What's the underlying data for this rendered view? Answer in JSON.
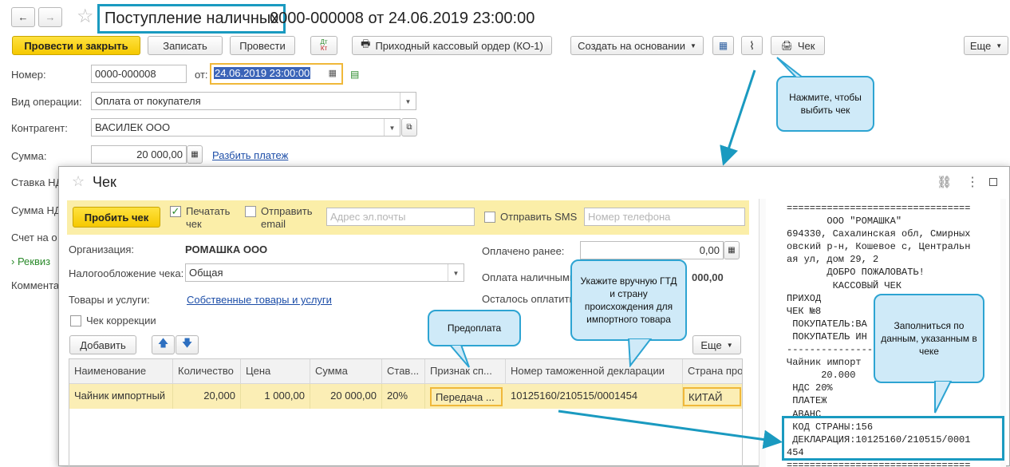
{
  "window": {
    "title_part1": "Поступление наличных",
    "title_part2": "0000-000008 от 24.06.2019 23:00:00",
    "nav_back": "←",
    "nav_forward": "→",
    "star": "☆"
  },
  "toolbar": {
    "post_close": "Провести и закрыть",
    "save": "Записать",
    "post": "Провести",
    "dt_kt_top": "Дт",
    "dt_kt_bottom": "Кт",
    "cash_order": "Приходный кассовый ордер (КО-1)",
    "create_basis": "Создать на основании",
    "receipt": "Чек",
    "more": "Еще"
  },
  "form": {
    "number_label": "Номер:",
    "number_value": "0000-000008",
    "from_label": "от:",
    "date_value": "24.06.2019 23:00:00",
    "operation_label": "Вид операции:",
    "operation_value": "Оплата от покупателя",
    "counterparty_label": "Контрагент:",
    "counterparty_value": "ВАСИЛЕК ООО",
    "sum_label": "Сумма:",
    "sum_value": "20 000,00",
    "split_link": "Разбить платеж",
    "vat_rate_label": "Ставка НД",
    "vat_sum_label": "Сумма НД",
    "account_label": "Счет на о",
    "requisites_label": "Реквиз",
    "comment_label": "Коммента"
  },
  "dialog": {
    "title": "Чек",
    "punch_button": "Пробить чек",
    "print_label_1": "Печатать",
    "print_label_2": "чек",
    "send_email_1": "Отправить",
    "send_email_2": "email",
    "email_placeholder": "Адрес эл.почты",
    "send_sms": "Отправить SMS",
    "phone_placeholder": "Номер телефона",
    "org_label": "Организация:",
    "org_value": "РОМАШКА ООО",
    "tax_label": "Налогообложение чека:",
    "tax_value": "Общая",
    "goods_label": "Товары и услуги:",
    "goods_link": "Собственные товары и услуги",
    "correction_label": "Чек коррекции",
    "paid_before_label": "Оплачено ранее:",
    "paid_before_value": "0,00",
    "cash_pay_label": "Оплата наличными",
    "cash_pay_value": "000,00",
    "remaining_label": "Осталось оплатить",
    "add_button": "Добавить",
    "more_button": "Еще"
  },
  "table": {
    "headers": [
      "Наименование",
      "Количество",
      "Цена",
      "Сумма",
      "Став...",
      "Признак сп...",
      "Номер таможенной декларации",
      "Страна про"
    ],
    "row": [
      "Чайник импортный",
      "20,000",
      "1 000,00",
      "20 000,00",
      "20%",
      "Передача ...",
      "10125160/210515/0001454",
      "КИТАЙ"
    ]
  },
  "receipt_lines": [
    "================================",
    "       ООО \"РОМАШКА\"",
    "694330, Сахалинская обл, Смирных",
    "овский р-н, Кошевое с, Центральн",
    "ая ул, дом 29, 2",
    "       ДОБРО ПОЖАЛОВАТЬ!",
    "        КАССОВЫЙ ЧЕК",
    "ПРИХОД",
    "ЧЕК №8",
    " ПОКУПАТЕЛЬ:ВА",
    " ПОКУПАТЕЛЬ ИН",
    "--------------------------------",
    "Чайник импорт",
    "      20.000",
    " НДС 20%",
    " ПЛАТЕЖ",
    " АВАНС",
    " КОД СТРАНЫ:156",
    " ДЕКЛАРАЦИЯ:10125160/210515/0001",
    "454",
    "================================"
  ],
  "callouts": {
    "receipt_hint": "Нажмите, чтобы выбить чек",
    "prepay": "Предоплата",
    "gtd_hint": "Укажите вручную ГТД и страну происхождения для импортного товара",
    "filled_hint": "Заполниться по данным, указанным в чеке"
  },
  "colors": {
    "accent_yellow": "#f5c800",
    "callout_border": "#2da4d2",
    "callout_fill": "#cfeaf8",
    "panel_yellow": "#fbeea8",
    "link_blue": "#1d4ea8"
  }
}
